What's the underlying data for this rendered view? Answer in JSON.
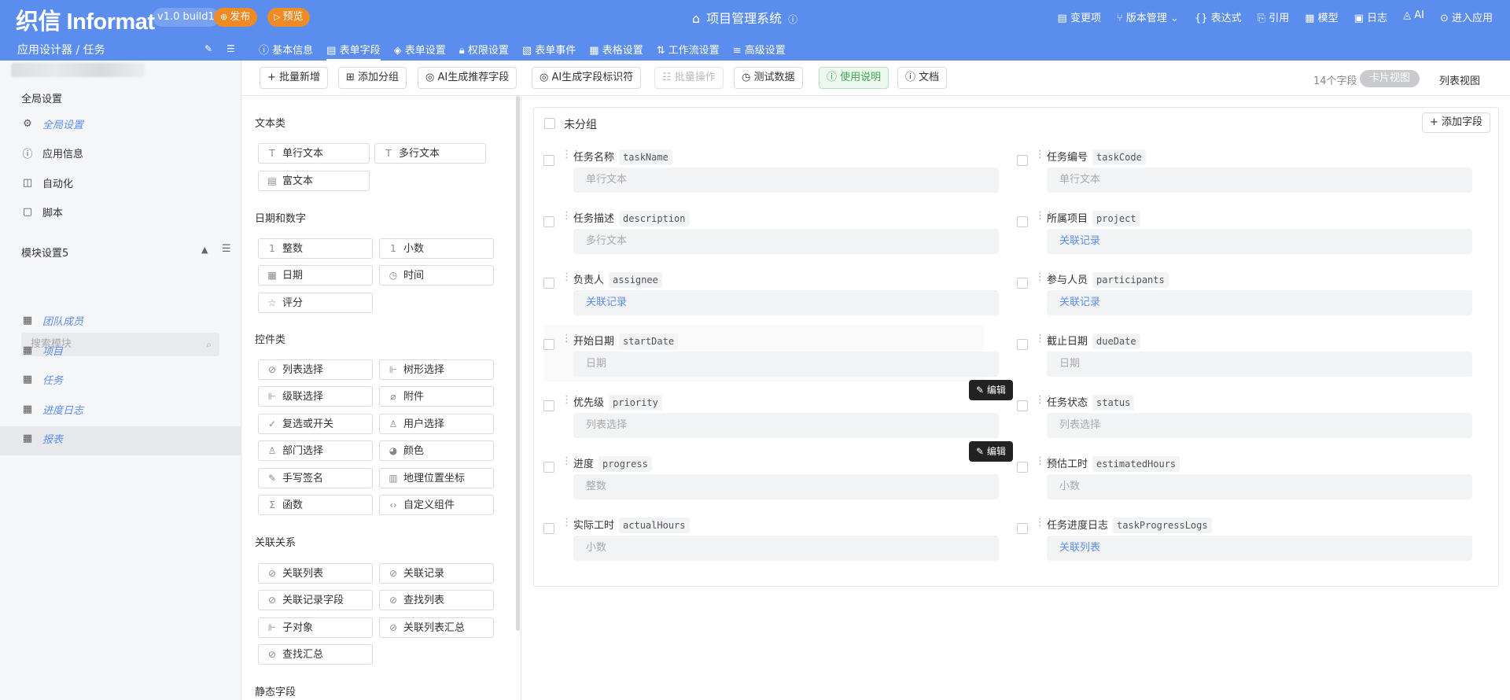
{
  "header": {
    "logo": "织信 Informat",
    "version": "v1.0 build1",
    "publish": "发布",
    "preview": "预览",
    "app_title": "项目管理系统",
    "nav": [
      "变更项",
      "版本管理",
      "表达式",
      "引用",
      "模型",
      "日志",
      "AI",
      "进入应用"
    ]
  },
  "breadcrumb": "应用设计器 / 任务",
  "tabs": [
    "基本信息",
    "表单字段",
    "表单设置",
    "权限设置",
    "表单事件",
    "表格设置",
    "工作流设置",
    "高级设置"
  ],
  "active_tab": "表单字段",
  "sidebar": {
    "global_title": "全局设置",
    "global_items": [
      "全局设置",
      "应用信息",
      "自动化",
      "脚本"
    ],
    "module_title": "模块设置5",
    "search_placeholder": "搜索模块",
    "modules": [
      "团队成员",
      "项目",
      "任务",
      "进度日志",
      "报表"
    ],
    "selected_module": "任务"
  },
  "toolbar": {
    "buttons": [
      "批量新增",
      "添加分组",
      "AI生成推荐字段",
      "AI生成字段标识符",
      "批量操作",
      "测试数据",
      "使用说明",
      "文档"
    ],
    "field_count": "14个字段",
    "card_view": "卡片视图",
    "list_view": "列表视图"
  },
  "palette": {
    "categories": [
      {
        "title": "文本类",
        "items": [
          "单行文本",
          "多行文本",
          "富文本"
        ]
      },
      {
        "title": "日期和数字",
        "items": [
          "整数",
          "小数",
          "日期",
          "时间",
          "评分"
        ]
      },
      {
        "title": "控件类",
        "items": [
          "列表选择",
          "树形选择",
          "级联选择",
          "附件",
          "复选或开关",
          "用户选择",
          "部门选择",
          "颜色",
          "手写签名",
          "地理位置坐标",
          "函数",
          "自定义组件"
        ]
      },
      {
        "title": "关联关系",
        "items": [
          "关联列表",
          "关联记录",
          "关联记录字段",
          "查找列表",
          "子对象",
          "关联列表汇总",
          "查找汇总"
        ]
      },
      {
        "title": "静态字段",
        "items": []
      }
    ]
  },
  "group": {
    "title": "未分组",
    "add_field": "添加字段",
    "edit_label": "编辑",
    "fields": [
      {
        "label": "任务名称",
        "code": "taskName",
        "type": "单行文本"
      },
      {
        "label": "任务编号",
        "code": "taskCode",
        "type": "单行文本"
      },
      {
        "label": "任务描述",
        "code": "description",
        "type": "多行文本"
      },
      {
        "label": "所属项目",
        "code": "project",
        "type": "关联记录"
      },
      {
        "label": "负责人",
        "code": "assignee",
        "type": "关联记录"
      },
      {
        "label": "参与人员",
        "code": "participants",
        "type": "关联记录"
      },
      {
        "label": "开始日期",
        "code": "startDate",
        "type": "日期"
      },
      {
        "label": "截止日期",
        "code": "dueDate",
        "type": "日期"
      },
      {
        "label": "优先级",
        "code": "priority",
        "type": "列表选择"
      },
      {
        "label": "任务状态",
        "code": "status",
        "type": "列表选择"
      },
      {
        "label": "进度",
        "code": "progress",
        "type": "整数"
      },
      {
        "label": "预估工时",
        "code": "estimatedHours",
        "type": "小数"
      },
      {
        "label": "实际工时",
        "code": "actualHours",
        "type": "小数"
      },
      {
        "label": "任务进度日志",
        "code": "taskProgressLogs",
        "type": "关联列表"
      }
    ]
  },
  "colors": {
    "header_bg": "#5b8def",
    "accent": "#5b8def",
    "publish": "#f08a24",
    "link": "#5b8def"
  }
}
